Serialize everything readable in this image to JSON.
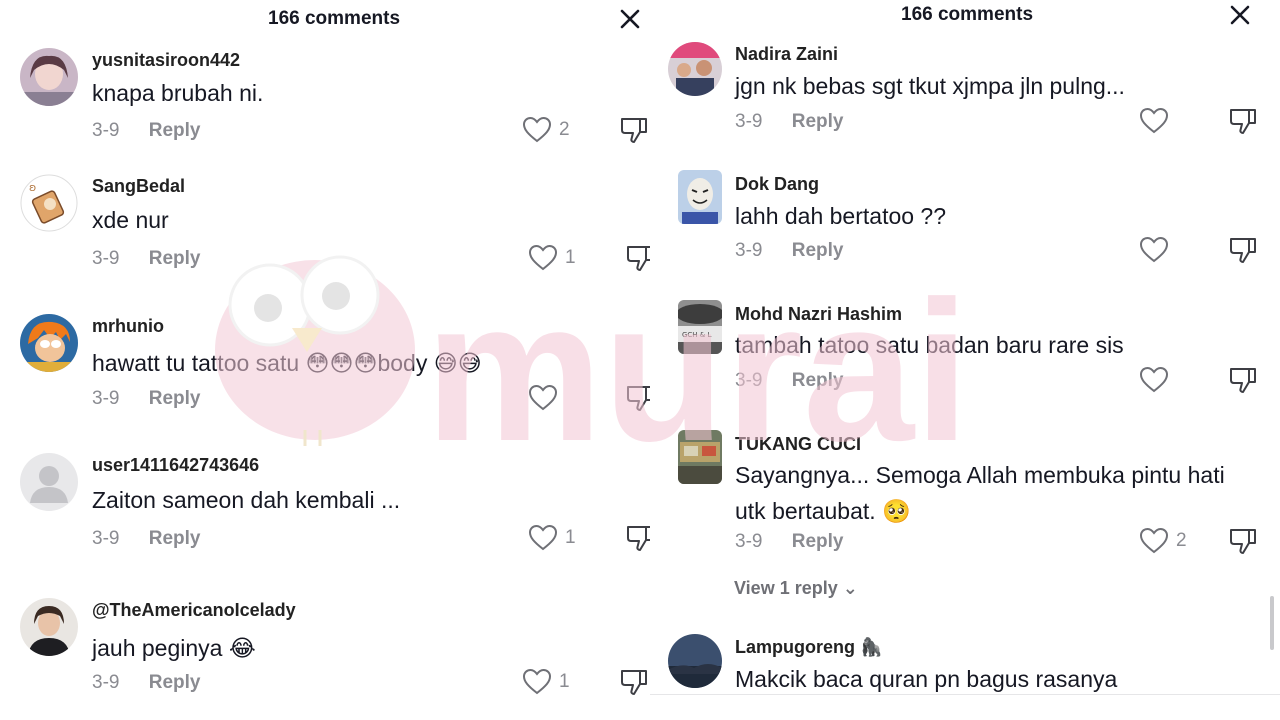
{
  "left": {
    "title": "166 comments",
    "comments": [
      {
        "username": "yusnitasiroon442",
        "text": "knapa brubah ni.",
        "date": "3-9",
        "reply": "Reply",
        "likes": "2"
      },
      {
        "username": "SangBedal",
        "text": "xde nur",
        "date": "3-9",
        "reply": "Reply",
        "likes": "1"
      },
      {
        "username": "mrhunio",
        "text": "hawatt tu tattoo satu 😳😳😳body 😅😅",
        "date": "3-9",
        "reply": "Reply",
        "likes": ""
      },
      {
        "username": "user1411642743646",
        "text": "Zaiton sameon dah kembali ...",
        "date": "3-9",
        "reply": "Reply",
        "likes": "1"
      },
      {
        "username": "@TheAmericanoIcelady",
        "text": "jauh peginya 😂",
        "date": "3-9",
        "reply": "Reply",
        "likes": "1"
      }
    ]
  },
  "right": {
    "title": "166 comments",
    "comments": [
      {
        "username": "Nadira Zaini",
        "text": "jgn nk bebas sgt tkut xjmpa jln pulng...",
        "date": "3-9",
        "reply": "Reply",
        "likes": ""
      },
      {
        "username": "Dok Dang",
        "text": "lahh dah bertatoo ??",
        "date": "3-9",
        "reply": "Reply",
        "likes": ""
      },
      {
        "username": "Mohd Nazri Hashim",
        "text": "tambah tatoo satu badan baru rare sis",
        "date": "3-9",
        "reply": "Reply",
        "likes": ""
      },
      {
        "username": "TUKANG CUCI",
        "text_line1": "Sayangnya... Semoga Allah membuka pintu hati",
        "text_line2": "utk bertaubat. 🥺",
        "date": "3-9",
        "reply": "Reply",
        "likes": "2"
      },
      {
        "username": "Lampugoreng 🦍",
        "text": "Makcik baca quran pn bagus rasanya"
      }
    ],
    "view_reply": "View 1 reply ⌄"
  },
  "watermark_text": "murai",
  "colors": {
    "accent": "#161823",
    "muted": "#8a8b91",
    "watermark": "#f4c6d4"
  }
}
